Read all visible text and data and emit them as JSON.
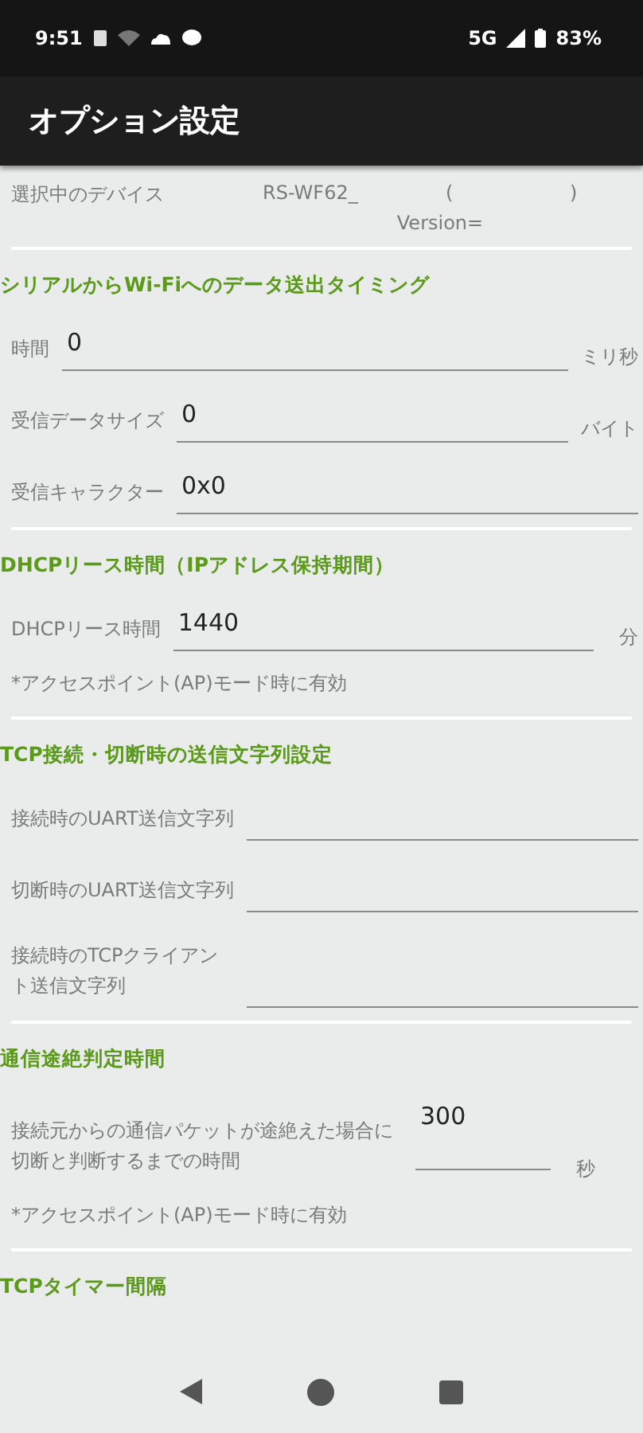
{
  "status_bar": {
    "time": "9:51",
    "network": "5G",
    "battery": "83%"
  },
  "app_bar": {
    "title": "オプション設定"
  },
  "device": {
    "label": "選択中のデバイス",
    "name": "RS-WF62_",
    "paren_open": "(",
    "paren_close": ")",
    "version": "Version="
  },
  "sections": [
    {
      "heading": "シリアルからWi-Fiへのデータ送出タイミング",
      "rows": [
        {
          "kind": "field",
          "label": "時間",
          "value": "0",
          "unit": "ミリ秒"
        },
        {
          "kind": "field",
          "label": "受信データサイズ",
          "value": "0",
          "unit": "バイト"
        },
        {
          "kind": "field",
          "label": "受信キャラクター",
          "value": "0x0"
        }
      ]
    },
    {
      "heading": "DHCPリース時間（IPアドレス保持期間）",
      "rows": [
        {
          "kind": "field",
          "label": "DHCPリース時間",
          "value": "1440",
          "unit": "分"
        }
      ],
      "note": "*アクセスポイント(AP)モード時に有効"
    },
    {
      "heading": "TCP接続・切断時の送信文字列設定",
      "rows": [
        {
          "kind": "field",
          "label": "接続時のUART送信文字列"
        },
        {
          "kind": "field",
          "label": "切断時のUART送信文字列"
        },
        {
          "kind": "wrapped",
          "label": "接続時のTCPクライアント送信文字列"
        }
      ]
    },
    {
      "heading": "通信途絶判定時間",
      "rows": [
        {
          "kind": "long",
          "label": "接続元からの通信パケットが途絶えた場合に切断と判断するまでの時間",
          "value": "300",
          "unit": "秒"
        }
      ],
      "note": "*アクセスポイント(AP)モード時に有効"
    },
    {
      "heading": "TCPタイマー間隔"
    }
  ]
}
